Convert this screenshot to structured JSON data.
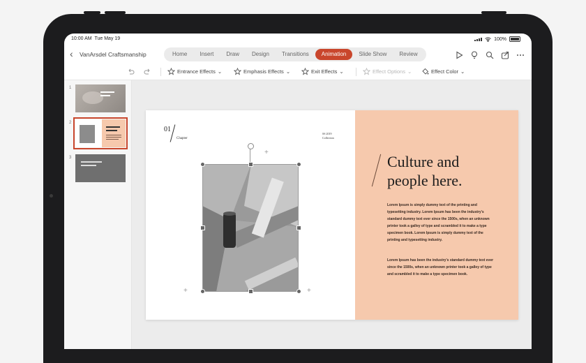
{
  "status": {
    "time": "10:00 AM",
    "date": "Tue May 19",
    "battery": "100%"
  },
  "titlebar": {
    "doc_title": "VanArsdel Craftsmanship",
    "tabs": [
      "Home",
      "Insert",
      "Draw",
      "Design",
      "Transitions",
      "Animation",
      "Slide Show",
      "Review"
    ],
    "active_tab": "Animation"
  },
  "ribbon": {
    "entrance": "Entrance Effects",
    "emphasis": "Emphasis Effects",
    "exit": "Exit Effects",
    "effect_options": "Effect Options",
    "effect_color": "Effect Color"
  },
  "thumbnails": {
    "numbers": [
      "1",
      "2",
      "3"
    ],
    "selected": "2"
  },
  "slide": {
    "chapter_num": "01",
    "chapter_label": "Chapter",
    "collection_line1": "SS 2019",
    "collection_line2": "Collection",
    "headline_line1": "Culture and",
    "headline_line2": "people here.",
    "para1": "Lorem Ipsum is simply dummy text of the printing and typesetting industry. Lorem Ipsum has been the industry's standard dummy text ever since the 1500s, when an unknown printer took a galley of type and scrambled it to make a type specimen book. Lorem Ipsum is simply dummy text of the printing and typesetting industry.",
    "para2": "Lorem Ipsum has been the industry's standard dummy text ever since the 1500s, when an unknown printer took a galley of type and scrambled it to make a type specimen book."
  },
  "colors": {
    "accent": "#c9462c",
    "slide_panel": "#f6c9ad"
  }
}
